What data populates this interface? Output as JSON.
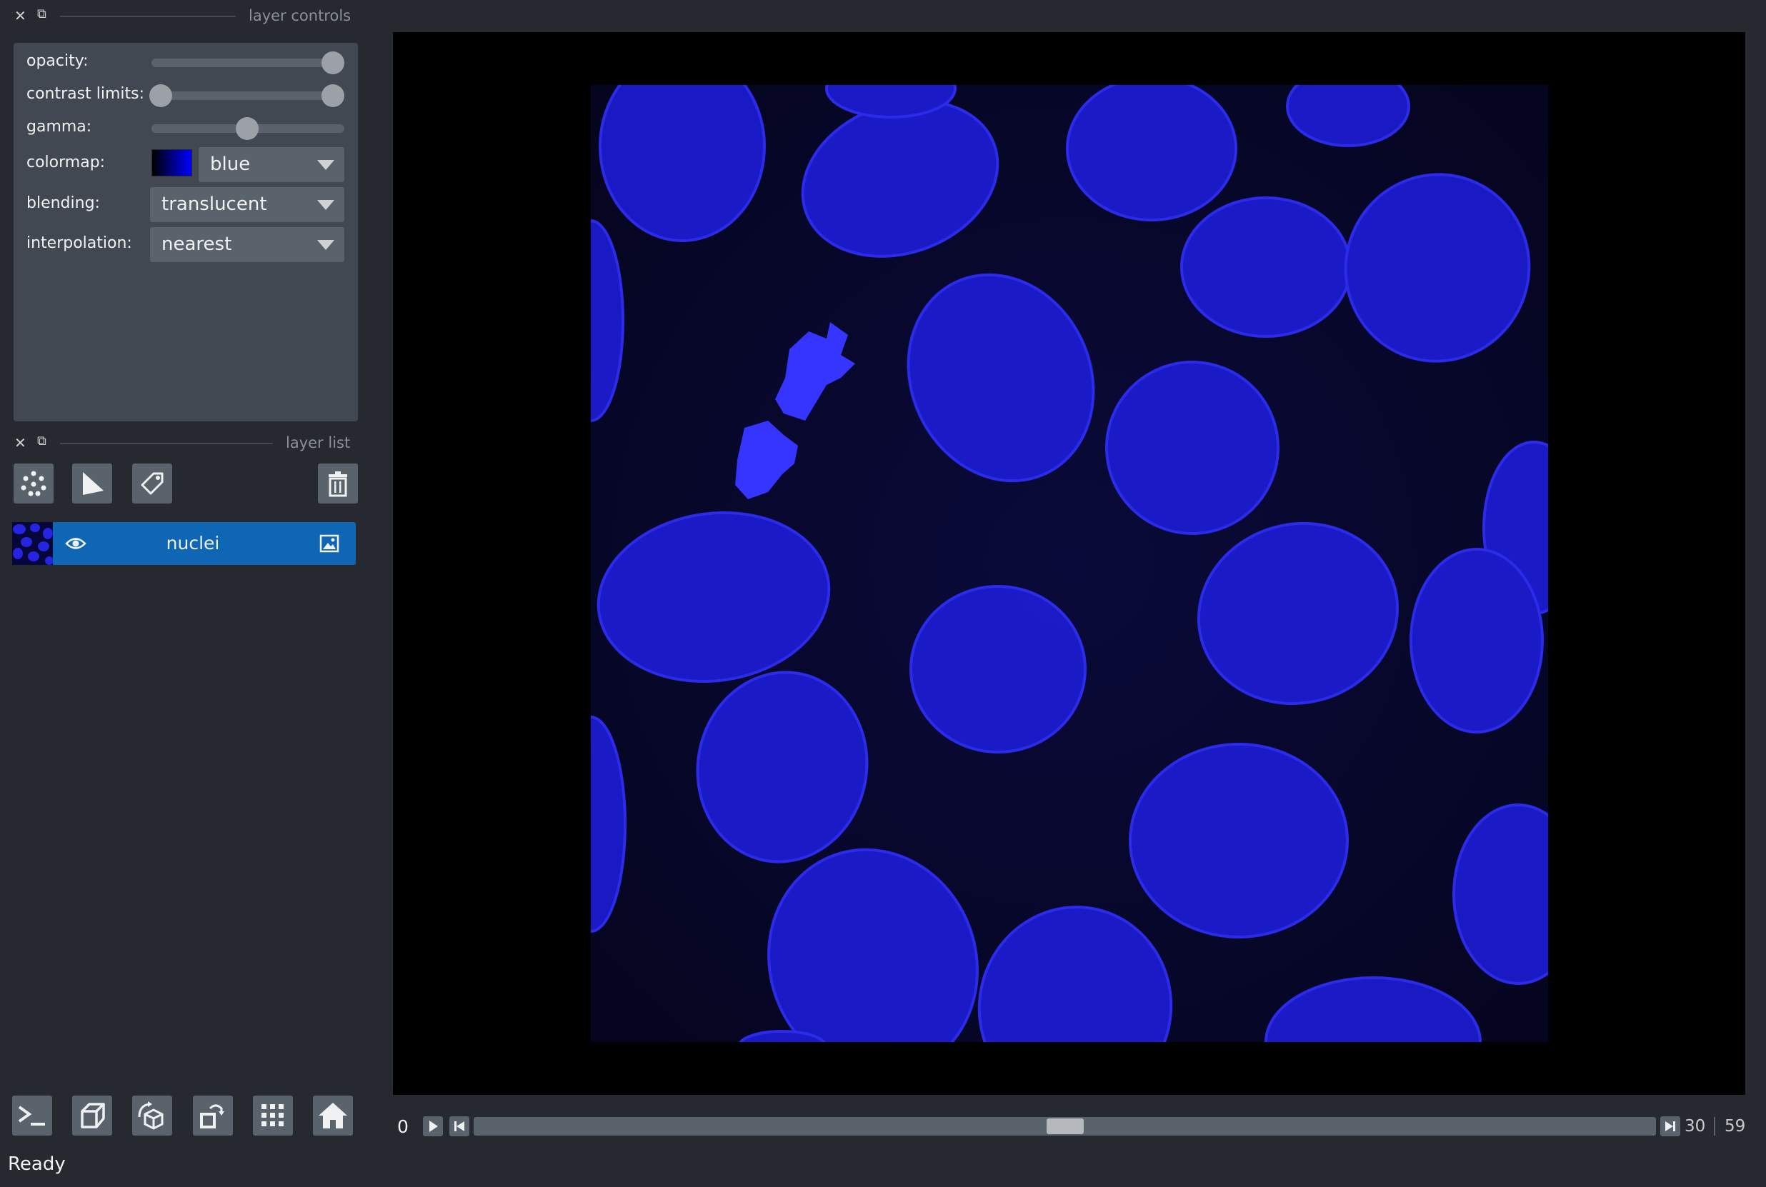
{
  "layer_controls": {
    "title": "layer controls",
    "opacity": {
      "label": "opacity:",
      "value": 1.0
    },
    "contrast_limits": {
      "label": "contrast limits:",
      "min": 0.0,
      "max": 1.0
    },
    "gamma": {
      "label": "gamma:",
      "value": 0.5
    },
    "colormap": {
      "label": "colormap:",
      "value": "blue"
    },
    "blending": {
      "label": "blending:",
      "value": "translucent"
    },
    "interpolation": {
      "label": "interpolation:",
      "value": "nearest"
    }
  },
  "layer_list": {
    "title": "layer list",
    "layers": [
      {
        "name": "nuclei",
        "visible": true,
        "type": "image"
      }
    ]
  },
  "dims": {
    "current": "0",
    "position_value": "30",
    "max_value": "59",
    "position_fraction": 0.5
  },
  "status": {
    "text": "Ready"
  },
  "colors": {
    "background": "#262930",
    "panel": "#414851",
    "control": "#5a626c",
    "selected_layer": "#0e66b5",
    "nuclei_blue": "#2a2aff"
  },
  "icons": {
    "bottom_toolbar": [
      "console-icon",
      "ndisplay-3d-icon",
      "roll-dims-icon",
      "transpose-dims-icon",
      "grid-icon",
      "home-icon"
    ]
  }
}
